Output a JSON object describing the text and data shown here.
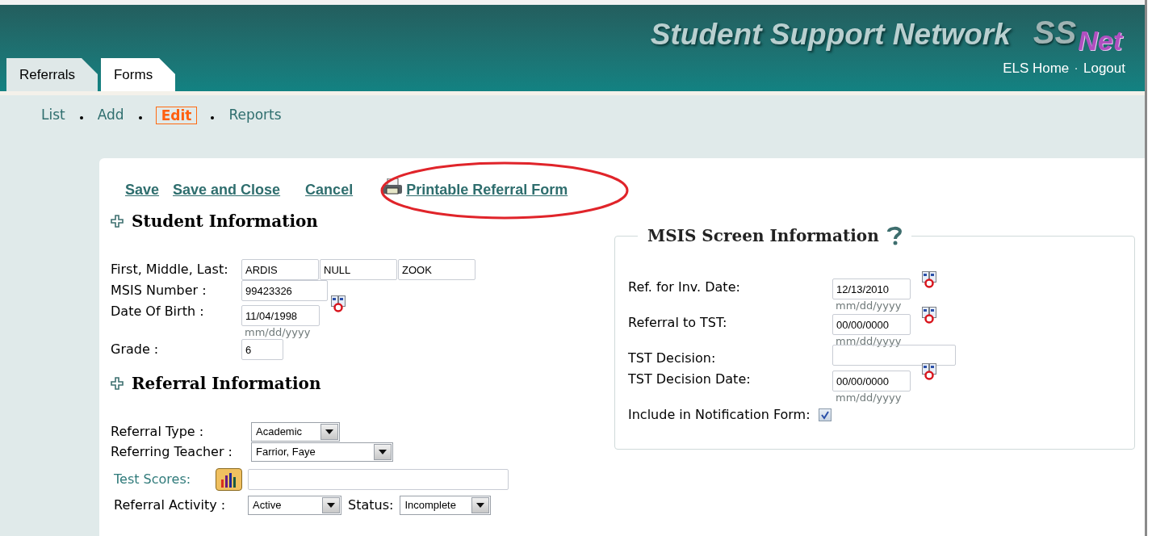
{
  "header": {
    "title": "Student Support Network",
    "logo": [
      "SS",
      "Net"
    ],
    "links": [
      {
        "label": "ELS Home"
      },
      {
        "label": "Logout"
      }
    ],
    "separator": "·"
  },
  "tabs": [
    {
      "label": "Referrals",
      "selected": false
    },
    {
      "label": "Forms",
      "selected": true
    }
  ],
  "subnav": [
    {
      "label": "List",
      "selected": false
    },
    {
      "label": "Add",
      "selected": false
    },
    {
      "label": "Edit",
      "selected": true
    },
    {
      "label": "Reports",
      "selected": false
    }
  ],
  "actions": [
    {
      "label": "Save",
      "kind": "link"
    },
    {
      "label": "Save and Close",
      "kind": "link"
    },
    {
      "label": "Cancel",
      "kind": "link"
    },
    {
      "label": "Printable Referral Form",
      "kind": "print"
    }
  ],
  "student_information": {
    "title": "Student Information",
    "fields": [
      {
        "label": "First, Middle, Last:",
        "kind": "multi",
        "values": [
          "ARDIS",
          "NULL",
          "ZOOK"
        ]
      },
      {
        "label": "MSIS Number :",
        "kind": "text",
        "value": "99423326"
      },
      {
        "label": "Date Of Birth :",
        "kind": "date",
        "value": "11/04/1998",
        "hint": "mm/dd/yyyy"
      },
      {
        "label": "Grade :",
        "kind": "short",
        "value": "6"
      }
    ]
  },
  "referral_information": {
    "title": "Referral Information",
    "fields": [
      {
        "label": "Referral Type :",
        "kind": "select",
        "value": "Academic"
      },
      {
        "label": "Referring Teacher :",
        "kind": "select-wide",
        "value": "Farrior, Faye"
      },
      {
        "label": "Test Scores:",
        "kind": "scores"
      },
      {
        "label": "Referral Activity :",
        "kind": "activity",
        "value": "Active",
        "status_label": "Status:",
        "status": "Incomplete"
      }
    ]
  },
  "msis_screen": {
    "title": "MSIS Screen Information",
    "fields": [
      {
        "label": "Ref. for Inv. Date:",
        "kind": "date",
        "value": "12/13/2010",
        "hint": "mm/dd/yyyy"
      },
      {
        "label": "Referral to TST:",
        "kind": "date",
        "value": "00/00/0000",
        "hint": "mm/dd/yyyy"
      },
      {
        "label": "TST Decision:",
        "kind": "text"
      },
      {
        "label": "TST Decision Date:",
        "kind": "date",
        "value": "00/00/0000",
        "hint": "mm/dd/yyyy"
      },
      {
        "label": "Include in Notification Form:",
        "kind": "checkbox",
        "checked": true
      }
    ]
  }
}
